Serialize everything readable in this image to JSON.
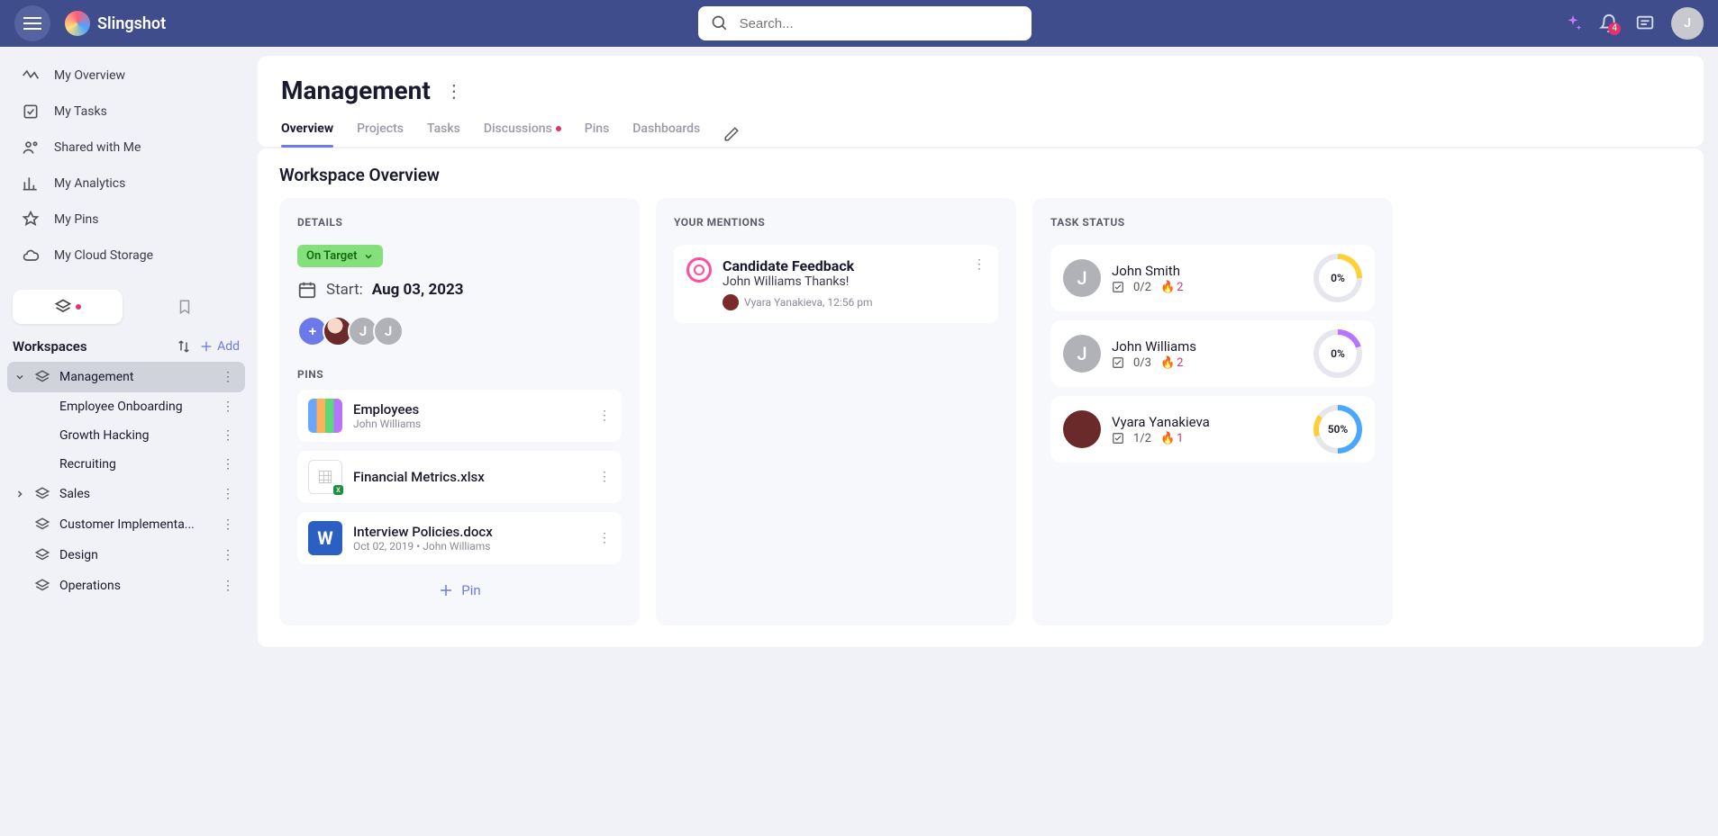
{
  "brand": "Slingshot",
  "search": {
    "placeholder": "Search..."
  },
  "notifications_count": "4",
  "user_initial": "J",
  "nav": [
    {
      "label": "My Overview"
    },
    {
      "label": "My Tasks"
    },
    {
      "label": "Shared with Me"
    },
    {
      "label": "My Analytics"
    },
    {
      "label": "My Pins"
    },
    {
      "label": "My Cloud Storage"
    }
  ],
  "workspaces_header": "Workspaces",
  "add_label": "Add",
  "workspaces": [
    {
      "label": "Management"
    },
    {
      "label": "Employee Onboarding"
    },
    {
      "label": "Growth Hacking"
    },
    {
      "label": "Recruiting"
    },
    {
      "label": "Sales"
    },
    {
      "label": "Customer Implementa..."
    },
    {
      "label": "Design"
    },
    {
      "label": "Operations"
    }
  ],
  "page_title": "Management",
  "tabs": {
    "overview": "Overview",
    "projects": "Projects",
    "tasks": "Tasks",
    "discussions": "Discussions",
    "pins": "Pins",
    "dashboards": "Dashboards"
  },
  "section_title": "Workspace Overview",
  "details": {
    "header": "DETAILS",
    "status": "On Target",
    "start_label": "Start:",
    "start_date": "Aug 03, 2023",
    "pins_header": "PINS",
    "pins": [
      {
        "title": "Employees",
        "sub": "John Williams"
      },
      {
        "title": "Financial Metrics.xlsx",
        "sub": ""
      },
      {
        "title": "Interview Policies.docx",
        "sub": "Oct 02, 2019 • John Williams"
      }
    ],
    "pin_add": "Pin"
  },
  "mentions": {
    "header": "YOUR MENTIONS",
    "item": {
      "title": "Candidate Feedback",
      "text": "John Williams Thanks!",
      "author": "Vyara Yanakieva, 12:56 pm"
    }
  },
  "taskstatus": {
    "header": "TASK STATUS",
    "rows": [
      {
        "name": "John Smith",
        "tasks": "0/2",
        "fire": "2",
        "pct": "0%"
      },
      {
        "name": "John Williams",
        "tasks": "0/3",
        "fire": "2",
        "pct": "0%"
      },
      {
        "name": "Vyara Yanakieva",
        "tasks": "1/2",
        "fire": "1",
        "pct": "50%"
      }
    ]
  }
}
